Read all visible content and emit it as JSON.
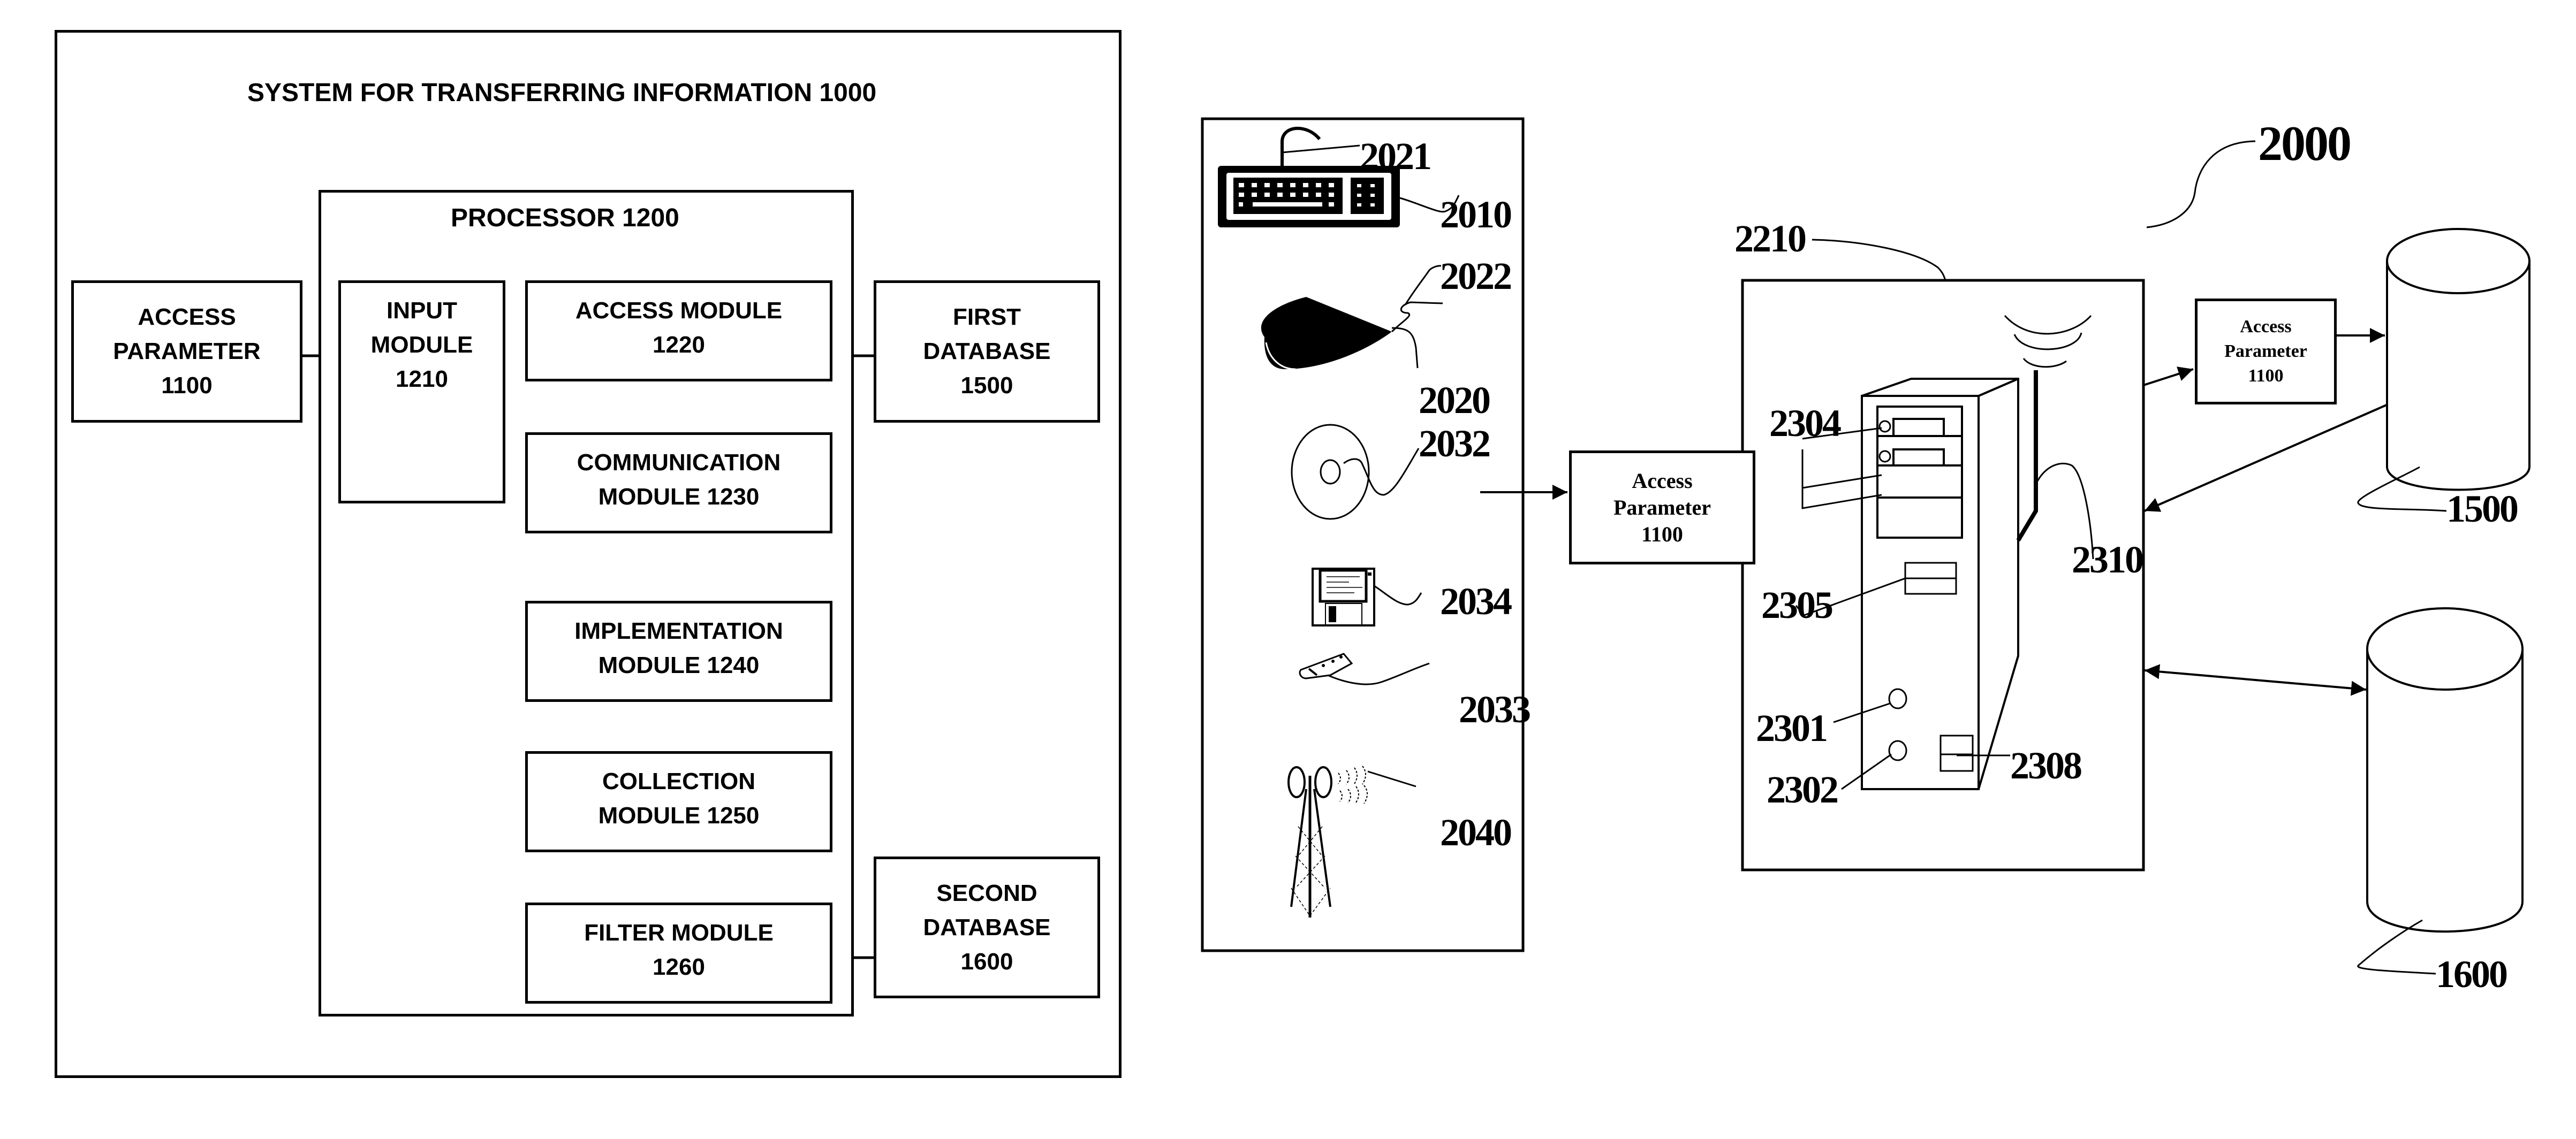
{
  "figure_left": {
    "system_title": "SYSTEM FOR TRANSFERRING INFORMATION 1000",
    "processor_title": "PROCESSOR 1200",
    "access_parameter": [
      "ACCESS",
      "PARAMETER",
      "1100"
    ],
    "input_module": [
      "INPUT",
      "MODULE",
      "1210"
    ],
    "modules": [
      {
        "lines": [
          "ACCESS MODULE",
          "1220"
        ]
      },
      {
        "lines": [
          "COMMUNICATION",
          "MODULE 1230"
        ]
      },
      {
        "lines": [
          "IMPLEMENTATION",
          "MODULE 1240"
        ]
      },
      {
        "lines": [
          "COLLECTION",
          "MODULE 1250"
        ]
      },
      {
        "lines": [
          "FILTER MODULE",
          "1260"
        ]
      }
    ],
    "first_database": [
      "FIRST",
      "DATABASE",
      "1500"
    ],
    "second_database": [
      "SECOND",
      "DATABASE",
      "1600"
    ]
  },
  "figure_right": {
    "system_ref": "2000",
    "devices": {
      "keyboard": "2010",
      "keyboard_cable": "2021",
      "mouse": "2020",
      "mouse_cable": "2022",
      "optical_disc": "2032",
      "floppy_disk": "2034",
      "usb_drive": "2033",
      "wireless_tower": "2040"
    },
    "access_parameter_mid": [
      "Access",
      "Parameter",
      "1100"
    ],
    "access_parameter_right": [
      "Access",
      "Parameter",
      "1100"
    ],
    "computer": {
      "enclosure": "2210",
      "drive_bays": "2304",
      "slot": "2305",
      "button_1": "2301",
      "button_2": "2302",
      "port": "2308",
      "antenna": "2310"
    },
    "database_1": "1500",
    "database_2": "1600"
  }
}
